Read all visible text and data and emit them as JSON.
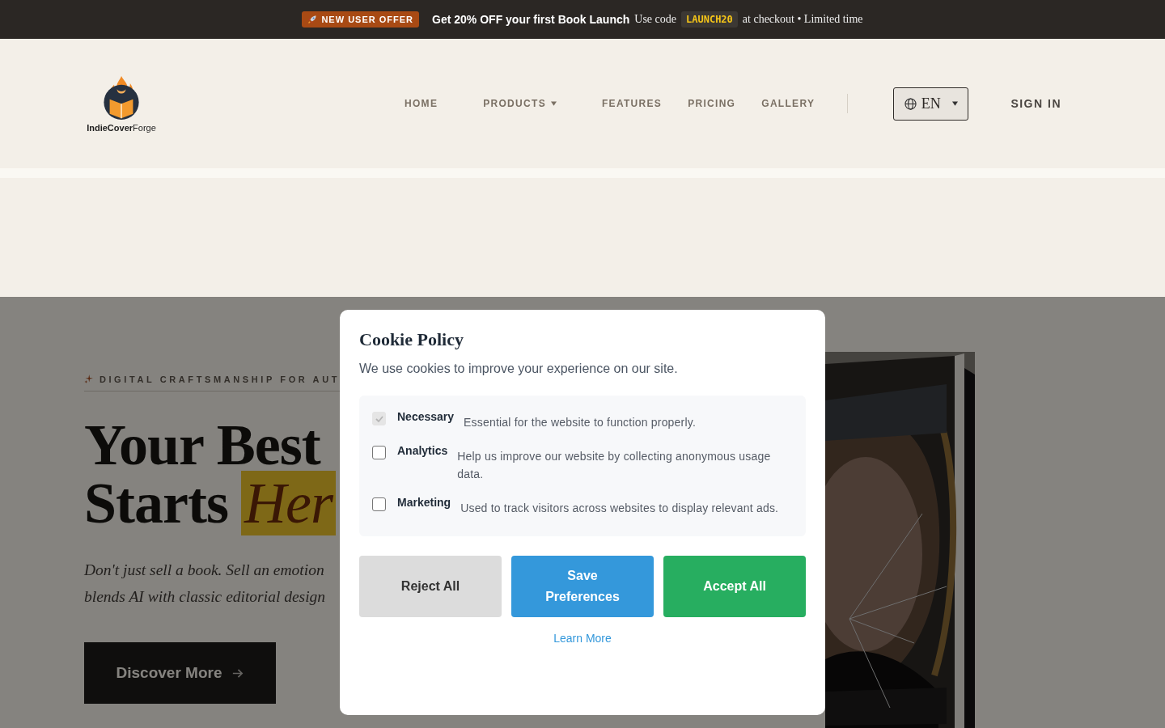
{
  "promo_bar": {
    "badge": "NEW USER OFFER",
    "headline": "Get 20% OFF your first Book Launch",
    "text_before": "Use code",
    "code": "LAUNCH20",
    "text_after": "at checkout • Limited time"
  },
  "header": {
    "logo_text_bold": "IndieCover",
    "logo_text": "Forge",
    "nav": [
      {
        "label": "HOME",
        "has_menu": false
      },
      {
        "label": "PRODUCTS",
        "has_menu": true
      },
      {
        "label": "FEATURES",
        "has_menu": false
      },
      {
        "label": "PRICING",
        "has_menu": false
      },
      {
        "label": "GALLERY",
        "has_menu": false
      }
    ],
    "language": "EN",
    "sign_in": "SIGN IN"
  },
  "hero": {
    "tagline": "DIGITAL CRAFTSMANSHIP FOR AUT",
    "title_line_1": "Your Best",
    "title_line_2": "Starts",
    "title_highlight": "Her",
    "subtitle_lines": [
      "Don't just sell a book. Sell an emotion",
      "blends AI with classic editorial design"
    ],
    "cta": "Discover More",
    "cover": {
      "kind": "picture"
    }
  },
  "cookie_dialog": {
    "title": "Cookie Policy",
    "intro": "We use cookies to improve your experience on our site.",
    "options": [
      {
        "name": "Necessary",
        "description": "Essential for the website to function properly.",
        "checked": true,
        "disabled": true
      },
      {
        "name": "Analytics",
        "description": "Help us improve our website by collecting anonymous usage data.",
        "checked": false,
        "disabled": false
      },
      {
        "name": "Marketing",
        "description": "Used to track visitors across websites to display relevant ads.",
        "checked": false,
        "disabled": false
      }
    ],
    "buttons": [
      {
        "label": "Reject All",
        "kind": "reject"
      },
      {
        "label": "Save Preferences",
        "kind": "save"
      },
      {
        "label": "Accept All",
        "kind": "accept"
      }
    ],
    "link": "Learn More"
  }
}
